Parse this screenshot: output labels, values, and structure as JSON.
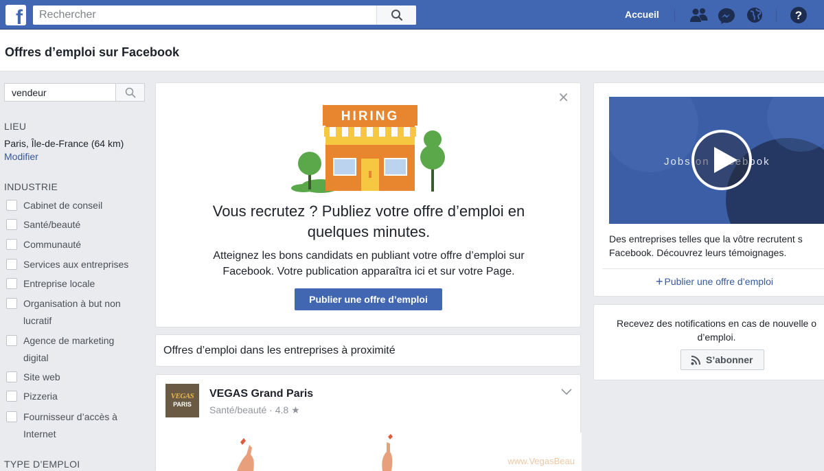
{
  "topbar": {
    "logo": "f",
    "search_placeholder": "Rechercher",
    "home_label": "Accueil",
    "icons": [
      "friends-icon",
      "messenger-icon",
      "globe-icon",
      "help-icon"
    ]
  },
  "page": {
    "title": "Offres d’emploi sur Facebook"
  },
  "filters": {
    "search_value": "vendeur",
    "location_label": "LIEU",
    "location_value": "Paris, Île-de-France (64 km)",
    "location_edit": "Modifier",
    "industry_label": "INDUSTRIE",
    "industries": [
      "Cabinet de conseil",
      "Santé/beauté",
      "Communauté",
      "Services aux entreprises",
      "Entreprise locale",
      "Organisation à but non lucratif",
      "Agence de marketing digital",
      "Site web",
      "Pizzeria",
      "Fournisseur d’accès à Internet"
    ],
    "next_section_label": "TYPE D’EMPLOI"
  },
  "hiring": {
    "close": "×",
    "sign_text": "HIRING",
    "title": "Vous recrutez ? Publiez votre offre d’emploi en quelques minutes.",
    "subtitle": "Atteignez les bons candidats en publiant votre offre d’emploi sur Facebook. Votre publication apparaîtra ici et sur votre Page.",
    "button": "Publier une offre d’emploi"
  },
  "nearby": {
    "title": "Offres d’emploi dans les entreprises à proximité"
  },
  "post": {
    "avatar_line1": "VEGAS",
    "avatar_line2": "PARIS",
    "business": "VEGAS Grand Paris",
    "meta": "Santé/beauté · 4.8 ★",
    "watermark": "www.VegasBeau"
  },
  "video": {
    "overlay_text": "Jobs on Facebook",
    "description": "Des entreprises telles que la vôtre recrutent s\nFacebook. Découvrez leurs témoignages.",
    "link_plus": "+",
    "link": "Publier une offre d’emploi"
  },
  "notifications": {
    "text": "Recevez des notifications en cas de nouvelle o\nd’emploi.",
    "button": "S’abonner"
  },
  "colors": {
    "brand": "#4267b2",
    "link": "#365899",
    "background": "#e9ebee"
  }
}
